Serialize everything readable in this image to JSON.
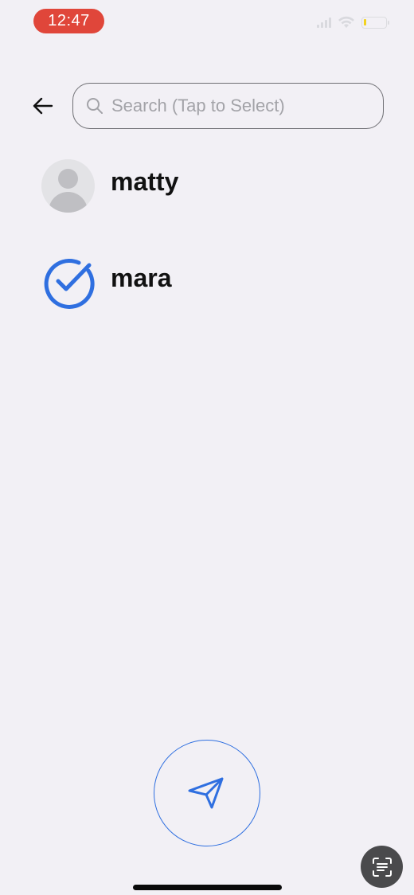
{
  "status_bar": {
    "time": "12:47",
    "icons": [
      "signal-icon",
      "wifi-icon",
      "battery-icon"
    ],
    "battery_level_percent": 10,
    "battery_color": "#f2d21e"
  },
  "search": {
    "placeholder": "Search (Tap to Select)",
    "value": ""
  },
  "contacts": [
    {
      "name": "matty",
      "selected": false,
      "icon": "default-avatar-icon"
    },
    {
      "name": "mara",
      "selected": true,
      "icon": "checkmark-circle-icon"
    }
  ],
  "actions": {
    "send_icon": "paper-plane-icon",
    "scan_icon": "scan-text-icon"
  },
  "colors": {
    "accent": "#2f6fe0",
    "time_pill": "#e0463a",
    "background": "#f2f0f5"
  }
}
